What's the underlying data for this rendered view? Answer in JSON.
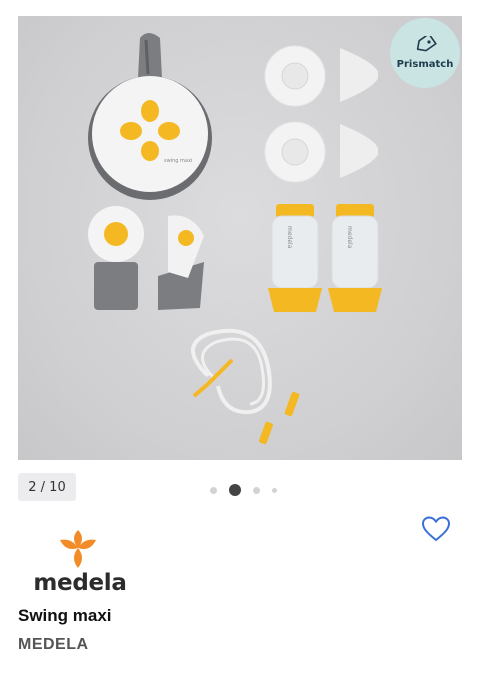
{
  "gallery": {
    "badge_label": "Prismatch",
    "badge_icon": "tag-icon",
    "counter": "2 / 10",
    "pagination": {
      "total_dots": 4,
      "active_index": 1
    },
    "product_image": {
      "device_label": "swing maxi",
      "bottle_label": "medela"
    }
  },
  "favorite": {
    "icon": "heart-outline-icon",
    "color": "#3a6fd8"
  },
  "brand": {
    "logo_word": "medela",
    "logo_icon": "medela-flower-icon",
    "accent_color": "#f28c28"
  },
  "product": {
    "name": "Swing maxi",
    "brand": "MEDELA"
  }
}
